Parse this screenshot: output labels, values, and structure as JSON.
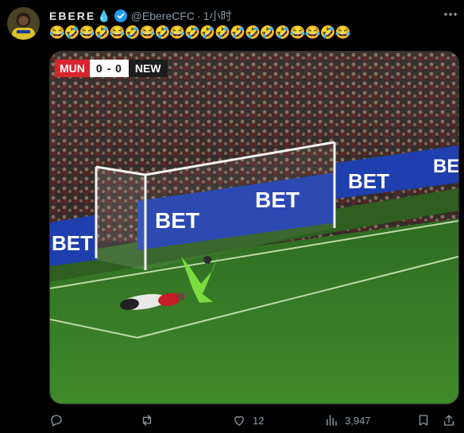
{
  "tweet": {
    "display_name": "EBERE",
    "name_emoji": "💧",
    "handle": "@EbereCFC",
    "separator": "·",
    "time": "1小时",
    "text": "😂🤣😂🤣😂🤣😂🤣😂🤣🤣🤣🤣🤣🤣🤣😂😂🤣😂"
  },
  "media": {
    "scoreboard": {
      "home": "MUN",
      "score": "0 - 0",
      "away": "NEW"
    },
    "ad_boards": [
      "BET",
      "BET",
      "BET",
      "BET",
      "BET"
    ]
  },
  "actions": {
    "reply_count": "",
    "retweet_count": "",
    "like_count": "12",
    "views_count": "3,947"
  },
  "icons": [
    "verified-badge-icon",
    "more-icon",
    "reply-icon",
    "retweet-icon",
    "like-icon",
    "views-icon",
    "bookmark-icon",
    "share-icon"
  ],
  "colors": {
    "background": "#000000",
    "text": "#e7e9ea",
    "muted": "#8b98a5",
    "verified": "#1d9bf0",
    "mun_red": "#d8242b",
    "pitch_green": "#3f8a2a"
  }
}
